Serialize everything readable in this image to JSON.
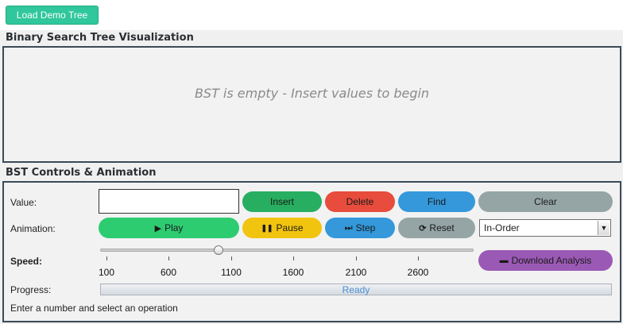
{
  "toolbar": {
    "load_demo_label": "Load Demo Tree"
  },
  "visualization": {
    "title": "Binary Search Tree Visualization",
    "empty_message": "BST is empty - Insert values to begin"
  },
  "controls": {
    "title": "BST Controls & Animation",
    "value_label": "Value:",
    "value_input": {
      "value": "",
      "placeholder": ""
    },
    "insert_label": "Insert",
    "delete_label": "Delete",
    "find_label": "Find",
    "clear_label": "Clear",
    "animation_label": "Animation:",
    "play_label": "Play",
    "pause_label": "Pause",
    "step_label": "Step",
    "reset_label": "Reset",
    "traversal_selected": "In-Order",
    "speed_label": "Speed:",
    "speed": {
      "min": 100,
      "max": 3000,
      "value": 1000
    },
    "speed_ticks": [
      "100",
      "600",
      "1100",
      "1600",
      "2100",
      "2600"
    ],
    "download_label": "Download Analysis",
    "progress_label": "Progress:",
    "progress_status": "Ready",
    "progress_fraction": 0,
    "status_message": "Enter a number and select an operation"
  },
  "colors": {
    "green": "#2ecc71",
    "dark_green": "#27ae60",
    "red": "#e74c3c",
    "blue": "#3498db",
    "gray": "#95a5a6",
    "yellow": "#f1c40f",
    "purple": "#9b59b6",
    "teal": "#2fc79b"
  },
  "icons": {
    "play": "play-icon",
    "pause": "pause-icon",
    "step": "step-forward-icon",
    "reset": "refresh-icon",
    "download": "folder-icon",
    "dropdown": "chevron-down-icon"
  }
}
